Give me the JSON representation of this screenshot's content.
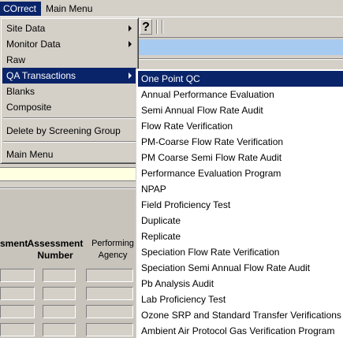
{
  "menubar": {
    "items": [
      {
        "label": "COrrect",
        "active": true
      },
      {
        "label": "Main Menu",
        "active": false
      }
    ]
  },
  "toolbar": {
    "help_label": "?"
  },
  "grid_headers": {
    "col1": "sment",
    "col2_line1": "Assessment",
    "col2_line2": "Number",
    "col3_line1": "Performing",
    "col3_line2": "Agency"
  },
  "correct_menu": {
    "items": [
      {
        "label": "Site Data",
        "has_submenu": true
      },
      {
        "label": "Monitor Data",
        "has_submenu": true
      },
      {
        "label": "Raw",
        "has_submenu": false
      },
      {
        "label": "QA Transactions",
        "has_submenu": true,
        "active": true
      },
      {
        "label": "Blanks",
        "has_submenu": false
      },
      {
        "label": "Composite",
        "has_submenu": false
      },
      {
        "label": "Delete by Screening Group",
        "has_submenu": false
      },
      {
        "label": "Main Menu",
        "has_submenu": false
      }
    ]
  },
  "qa_submenu": {
    "items": [
      {
        "label": "One Point QC",
        "active": true
      },
      {
        "label": "Annual Performance Evaluation"
      },
      {
        "label": "Semi Annual Flow Rate Audit"
      },
      {
        "label": "Flow Rate Verification"
      },
      {
        "label": "PM-Coarse Flow Rate Verification"
      },
      {
        "label": "PM Coarse Semi Flow Rate Audit"
      },
      {
        "label": "Performance Evaluation Program"
      },
      {
        "label": "NPAP"
      },
      {
        "label": "Field Proficiency Test"
      },
      {
        "label": "Duplicate"
      },
      {
        "label": "Replicate"
      },
      {
        "label": "Speciation Flow Rate Verification"
      },
      {
        "label": "Speciation Semi Annual Flow Rate Audit"
      },
      {
        "label": "Pb Analysis Audit"
      },
      {
        "label": "Lab Proficiency Test"
      },
      {
        "label": "Ozone SRP and Standard Transfer Verifications"
      },
      {
        "label": "Ambient Air Protocol Gas Verification Program"
      }
    ]
  },
  "colors": {
    "highlight": "#0a246a",
    "menu_face": "#d4d0c8",
    "tooltip_yellow": "#ffffe1",
    "header_blue": "#a6caf0"
  }
}
